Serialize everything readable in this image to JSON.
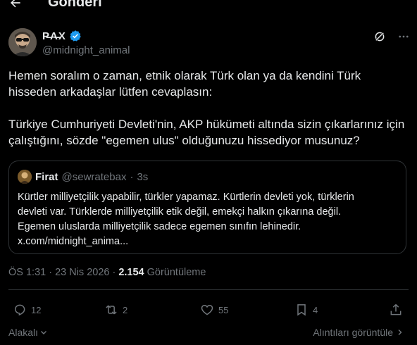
{
  "header": {
    "title": "Gönderi"
  },
  "author": {
    "display_name": "P̶A̶X",
    "handle": "@midnight_animal"
  },
  "tweet": {
    "text": "Hemen soralım o zaman, etnik olarak Türk olan ya da kendini Türk hisseden arkadaşlar lütfen cevaplasın:\n\nTürkiye Cumhuriyeti Devleti'nin, AKP hükümeti altında sizin çıkarlarınız için çalıştığını, sözde \"egemen ulus\" olduğunuzu hissediyor musunuz?"
  },
  "quote": {
    "name": "Firat",
    "handle": "@sewratebax",
    "dot": "·",
    "time": "3s",
    "lines": [
      "Kürtler milliyetçilik yapabilir, türkler yapamaz. Kürtlerin devleti yok, türklerin",
      "devleti var. Türklerde milliyetçilik etik değil, emekçi halkın çıkarına değil.",
      "Egemen uluslarda milliyetçilik sadece egemen sınıfın lehinedir.",
      "x.com/midnight_anima..."
    ]
  },
  "meta": {
    "timestamp": "ÖS 1:31 · 23 Nis 2026 ·",
    "views": "2.154",
    "views_label": "Görüntüleme"
  },
  "actions": {
    "replies": "12",
    "reposts": "2",
    "likes": "55",
    "bookmarks": "4"
  },
  "footer": {
    "related": "Alakalı",
    "quotes_link": "Alıntıları görüntüle"
  },
  "colors": {
    "background": "#000000",
    "text": "#e7e9ea",
    "muted": "#71767b",
    "border": "#2f3336",
    "verified": "#1d9bf0"
  }
}
